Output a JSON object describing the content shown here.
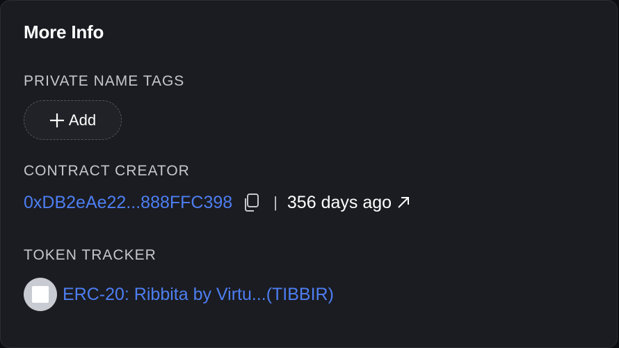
{
  "card": {
    "title": "More Info"
  },
  "private_name_tags": {
    "label": "PRIVATE NAME TAGS",
    "add_button_label": "Add"
  },
  "contract_creator": {
    "label": "CONTRACT CREATOR",
    "address": "0xDB2eAe22...888FFC398",
    "separator": "|",
    "age": "356 days ago"
  },
  "token_tracker": {
    "label": "TOKEN TRACKER",
    "token_name": "ERC-20: Ribbita by Virtu...(TIBBIR)"
  },
  "colors": {
    "background": "#1b1c21",
    "link": "#4d7ef2",
    "text": "#ffffff",
    "muted": "#c6c7cc"
  },
  "icons": [
    "plus-icon",
    "copy-icon",
    "external-arrow-icon",
    "token-logo-icon"
  ]
}
